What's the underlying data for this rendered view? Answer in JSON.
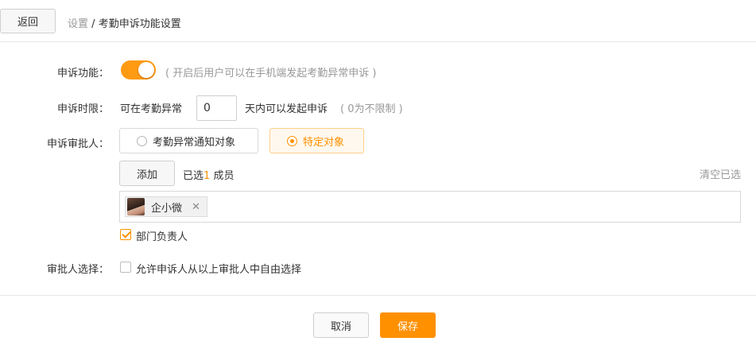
{
  "header": {
    "back_label": "返回",
    "breadcrumb_parent": "设置",
    "breadcrumb_separator": "/",
    "breadcrumb_current": "考勤申诉功能设置"
  },
  "appeal_function": {
    "label": "申诉功能：",
    "enabled": true,
    "hint": "( 开启后用户可以在手机端发起考勤异常申诉 )"
  },
  "time_limit": {
    "label": "申诉时限：",
    "prefix": "可在考勤异常",
    "value": "0",
    "suffix": "天内可以发起申诉",
    "hint": "( 0为不限制 )"
  },
  "approver": {
    "label": "申诉审批人：",
    "options": [
      {
        "label": "考勤异常通知对象",
        "selected": false
      },
      {
        "label": "特定对象",
        "selected": true
      }
    ],
    "add_label": "添加",
    "selected_prefix": "已选",
    "selected_count": "1",
    "selected_suffix": "成员",
    "clear_label": "清空已选",
    "members": [
      {
        "name": "企小微",
        "remove_icon": "close-icon"
      }
    ],
    "dept_head": {
      "label": "部门负责人",
      "checked": true
    }
  },
  "approver_choice": {
    "label": "审批人选择：",
    "checkbox_label": "允许申诉人从以上审批人中自由选择",
    "checked": false
  },
  "footer": {
    "cancel_label": "取消",
    "save_label": "保存"
  },
  "colors": {
    "accent": "#ff9000",
    "toggle_on": "#ff9a13",
    "hint_text": "#999999"
  }
}
